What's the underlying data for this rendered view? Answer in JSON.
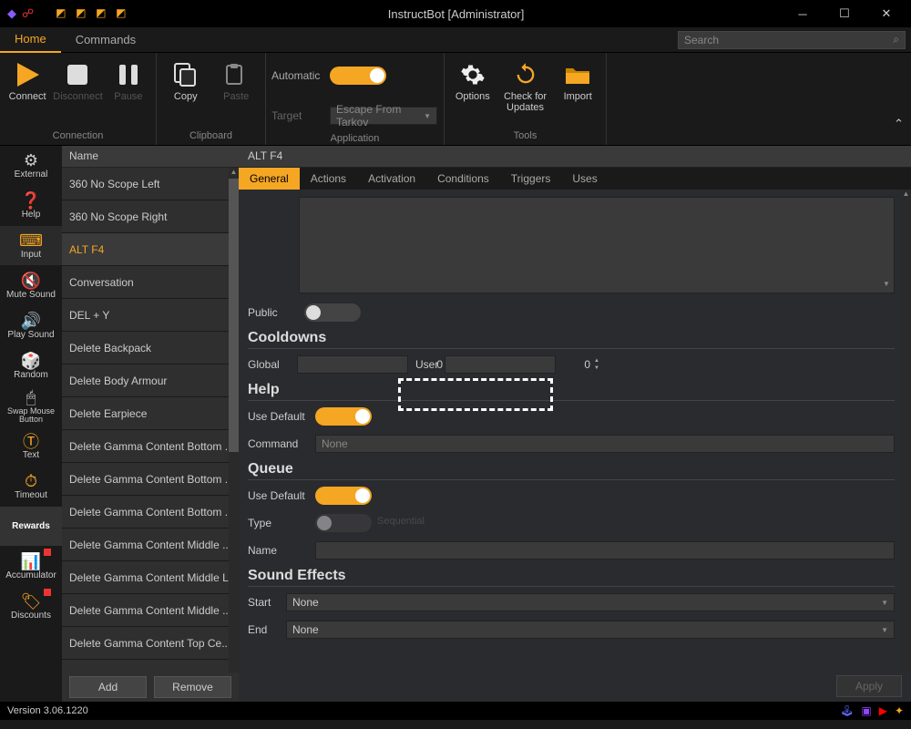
{
  "window": {
    "title": "InstructBot [Administrator]"
  },
  "menu": {
    "tabs": [
      "Home",
      "Commands"
    ],
    "active": 0,
    "search_placeholder": "Search"
  },
  "ribbon": {
    "groups": [
      {
        "title": "Connection",
        "buttons": [
          {
            "key": "connect",
            "label": "Connect",
            "disabled": false
          },
          {
            "key": "disconnect",
            "label": "Disconnect",
            "disabled": true
          },
          {
            "key": "pause",
            "label": "Pause",
            "disabled": true
          }
        ]
      },
      {
        "title": "Clipboard",
        "buttons": [
          {
            "key": "copy",
            "label": "Copy",
            "disabled": false
          },
          {
            "key": "paste",
            "label": "Paste",
            "disabled": true
          }
        ]
      },
      {
        "title": "Application",
        "automatic_label": "Automatic",
        "automatic_on": true,
        "target_label": "Target",
        "target_value": "Escape From Tarkov"
      },
      {
        "title": "Tools",
        "buttons": [
          {
            "key": "options",
            "label": "Options"
          },
          {
            "key": "check",
            "label": "Check for Updates"
          },
          {
            "key": "import",
            "label": "Import"
          }
        ]
      }
    ]
  },
  "sidebar": [
    {
      "label": "External",
      "icon": "gear"
    },
    {
      "label": "Help",
      "icon": "help"
    },
    {
      "label": "Input",
      "icon": "cursor"
    },
    {
      "label": "Mute Sound",
      "icon": "mute"
    },
    {
      "label": "Play Sound",
      "icon": "sound"
    },
    {
      "label": "Random",
      "icon": "dice"
    },
    {
      "label": "Swap Mouse Button",
      "icon": "mouse"
    },
    {
      "label": "Text",
      "icon": "text"
    },
    {
      "label": "Timeout",
      "icon": "timer"
    },
    {
      "label": "Rewards",
      "icon": "",
      "selected": true
    },
    {
      "label": "Accumulator",
      "icon": "accum",
      "badged": true
    },
    {
      "label": "Discounts",
      "icon": "tag",
      "badged": true
    }
  ],
  "list": {
    "header": "Name",
    "selected": "ALT F4",
    "items": [
      "360 No Scope Left",
      "360 No Scope Right",
      "ALT F4",
      "Conversation",
      "DEL + Y",
      "Delete Backpack",
      "Delete Body Armour",
      "Delete Earpiece",
      "Delete Gamma Content Bottom ...",
      "Delete Gamma Content Bottom ...",
      "Delete Gamma Content Bottom ...",
      "Delete Gamma Content Middle ...",
      "Delete Gamma Content Middle L...",
      "Delete Gamma Content Middle ...",
      "Delete Gamma Content Top Ce..."
    ],
    "add_label": "Add",
    "remove_label": "Remove"
  },
  "detail": {
    "title": "ALT F4",
    "tabs": [
      "General",
      "Actions",
      "Activation",
      "Conditions",
      "Triggers",
      "Uses"
    ],
    "active_tab": 0,
    "general": {
      "public_label": "Public",
      "public_on": false,
      "cooldowns_title": "Cooldowns",
      "global_label": "Global",
      "global_value": "0",
      "user_label": "User",
      "user_value": "0",
      "help_title": "Help",
      "use_default_label": "Use Default",
      "help_use_default_on": true,
      "command_label": "Command",
      "command_value": "None",
      "queue_title": "Queue",
      "queue_use_default_on": true,
      "type_label": "Type",
      "type_hint": "Sequential",
      "type_on": false,
      "name_label": "Name",
      "name_value": "",
      "sfx_title": "Sound Effects",
      "start_label": "Start",
      "start_value": "None",
      "end_label": "End",
      "end_value": "None"
    },
    "apply_label": "Apply"
  },
  "status": {
    "version": "Version 3.06.1220"
  }
}
